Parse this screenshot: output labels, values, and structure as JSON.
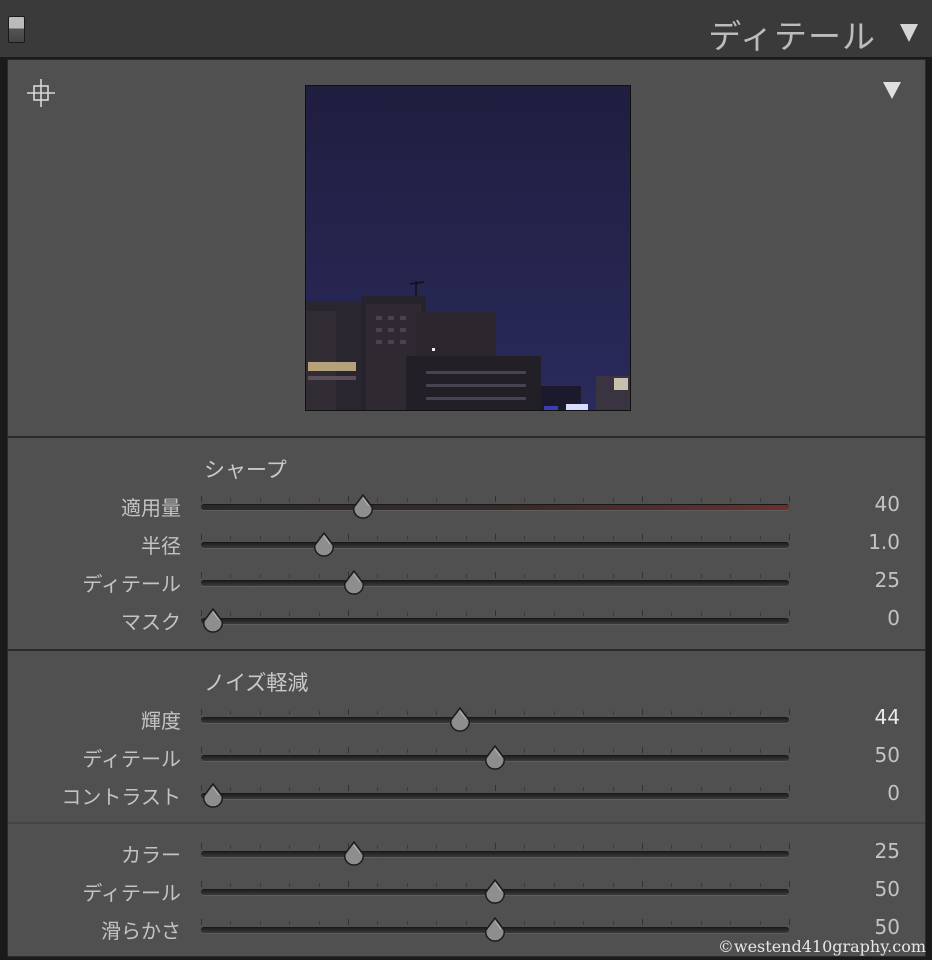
{
  "header": {
    "title": "ディテール"
  },
  "sharpen": {
    "title": "シャープ",
    "sliders": [
      {
        "label": "適用量",
        "value": "40",
        "fraction": 0.275,
        "tint": true
      },
      {
        "label": "半径",
        "value": "1.0",
        "fraction": 0.21
      },
      {
        "label": "ディテール",
        "value": "25",
        "fraction": 0.26
      },
      {
        "label": "マスク",
        "value": "0",
        "fraction": 0.02
      }
    ]
  },
  "noise": {
    "title": "ノイズ軽減",
    "luminance": [
      {
        "label": "輝度",
        "value": "44",
        "fraction": 0.44,
        "bright": true
      },
      {
        "label": "ディテール",
        "value": "50",
        "fraction": 0.5
      },
      {
        "label": "コントラスト",
        "value": "0",
        "fraction": 0.02
      }
    ],
    "color": [
      {
        "label": "カラー",
        "value": "25",
        "fraction": 0.26
      },
      {
        "label": "ディテール",
        "value": "50",
        "fraction": 0.5
      },
      {
        "label": "滑らかさ",
        "value": "50",
        "fraction": 0.5
      }
    ]
  },
  "watermark": "©westend410graphy.com",
  "icons": {
    "panel_switch": "panel-switch-icon",
    "collapse": "triangle-down-icon",
    "target": "target-adjustment-icon"
  }
}
